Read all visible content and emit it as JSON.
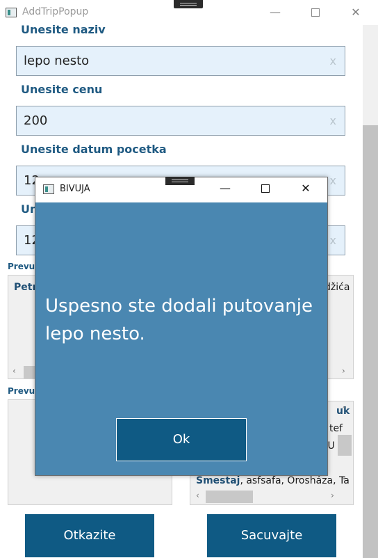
{
  "window": {
    "title": "AddTripPopup"
  },
  "form": {
    "name_label": "Unesite naziv",
    "name_value": "lepo nesto",
    "price_label": "Unesite cenu",
    "price_value": "200",
    "start_label": "Unesite datum pocetka",
    "start_value": "12",
    "end_label": "Un",
    "end_value": "12",
    "clear_glyph": "x"
  },
  "lists": {
    "top_label": "Prevuci",
    "top_left_item_bold": "Petro",
    "top_right_partial": "džića",
    "bottom_label": "Prevuci",
    "bottom_right_rows": [
      "uk",
      "tef",
      "a, U"
    ],
    "bottom_right_item_bold": "Smestaj",
    "bottom_right_item_rest": ", asfsafa, Orosháza, Ta"
  },
  "buttons": {
    "cancel": "Otkazite",
    "save": "Sacuvajte"
  },
  "dialog": {
    "title": "BIVUJA",
    "message": "Uspesno ste dodali putovanje lepo nesto.",
    "ok": "Ok"
  }
}
